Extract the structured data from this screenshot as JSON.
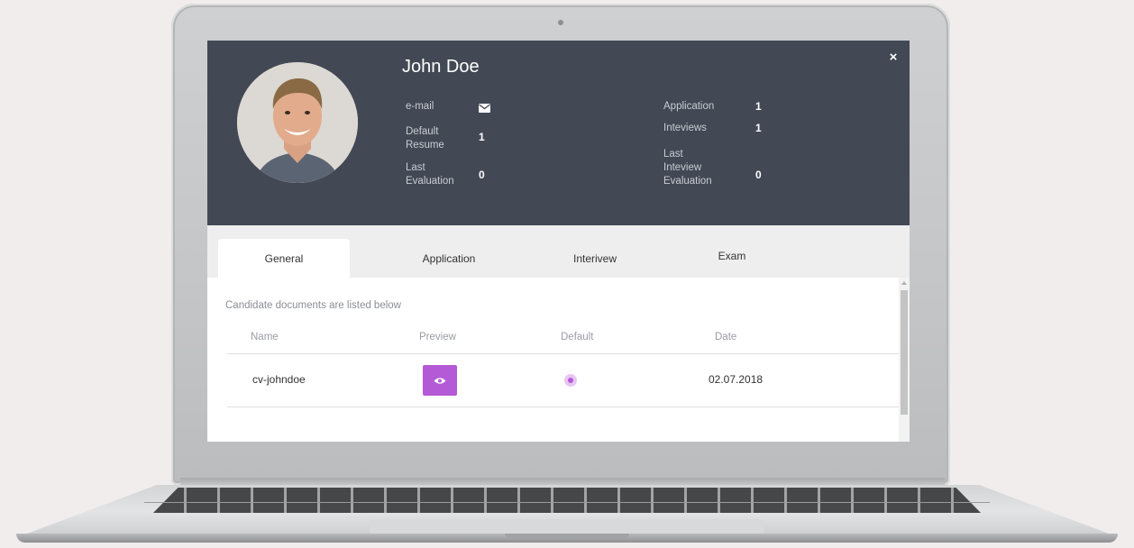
{
  "profile": {
    "name": "John Doe",
    "email_label": "e-mail",
    "default_resume_label": "Default Resume",
    "default_resume_value": "1",
    "last_evaluation_label": "Last Evaluation",
    "last_evaluation_value": "0",
    "application_label": "Application",
    "application_value": "1",
    "interviews_label": "Inteviews",
    "interviews_value": "1",
    "last_interview_eval_label": "Last Inteview Evaluation",
    "last_interview_eval_value": "0",
    "close_glyph": "×"
  },
  "tabs": [
    {
      "label": "General",
      "active": true
    },
    {
      "label": "Application",
      "active": false
    },
    {
      "label": "Interivew",
      "active": false
    },
    {
      "label": "Exam",
      "active": false
    }
  ],
  "documents": {
    "caption": "Candidate documents are listed below",
    "columns": [
      "Name",
      "Preview",
      "Default",
      "Date"
    ],
    "rows": [
      {
        "name": "cv-johndoe",
        "preview_icon": "eye-icon",
        "default": true,
        "date": "02.07.2018"
      }
    ]
  },
  "colors": {
    "header_bg": "#424854",
    "accent": "#b45ad6",
    "tabbar_bg": "#eeeeee"
  }
}
